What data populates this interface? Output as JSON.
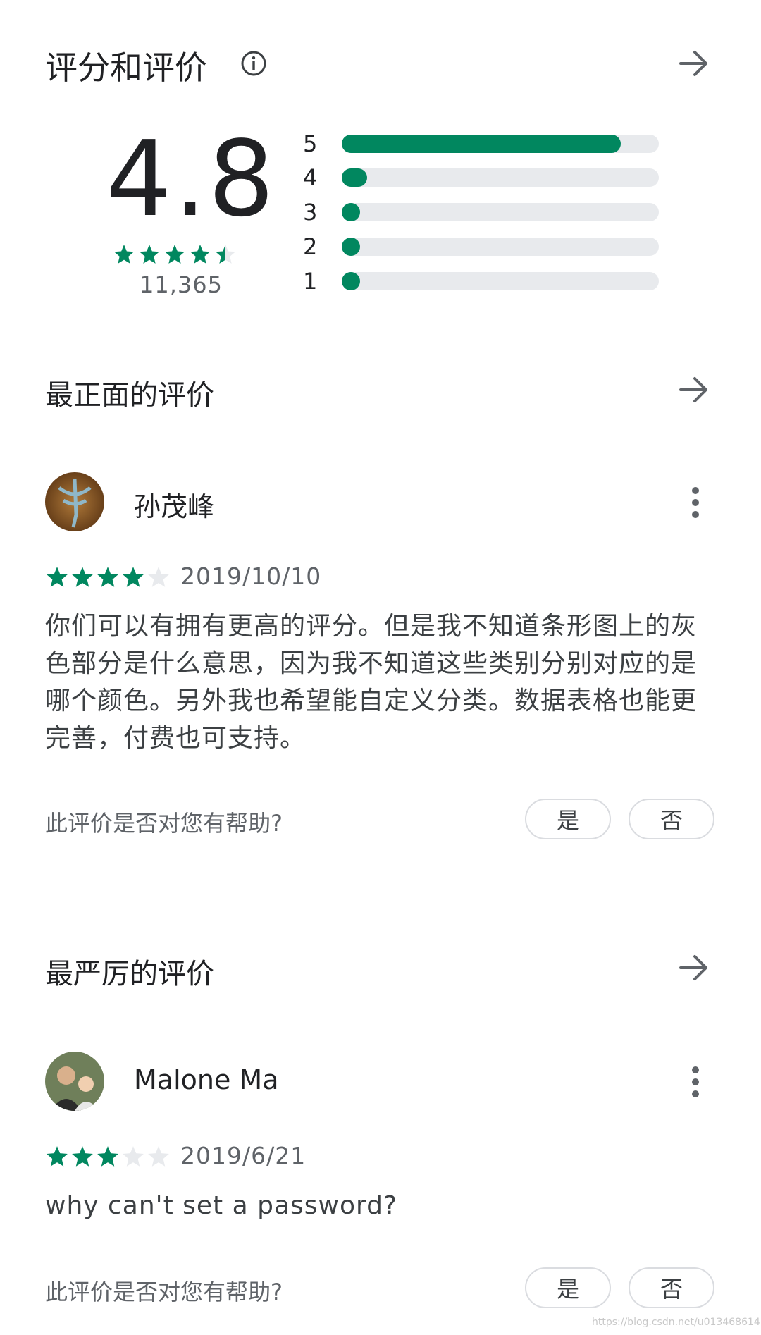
{
  "header": {
    "title": "评分和评价",
    "info_icon": "info-icon",
    "arrow_icon": "arrow-right-icon"
  },
  "summary": {
    "average": "4.8",
    "average_value": 4.8,
    "stars_filled": 4.5,
    "count": "11,365",
    "histogram": [
      {
        "label": "5",
        "fraction": 0.88
      },
      {
        "label": "4",
        "fraction": 0.08
      },
      {
        "label": "3",
        "fraction": 0.03
      },
      {
        "label": "2",
        "fraction": 0.03
      },
      {
        "label": "1",
        "fraction": 0.03
      }
    ]
  },
  "positive": {
    "section_title": "最正面的评价",
    "reviewer": "孙茂峰",
    "stars": 4,
    "date": "2019/10/10",
    "text": "你们可以有拥有更高的评分。但是我不知道条形图上的灰色部分是什么意思，因为我不知道这些类别分别对应的是哪个颜色。另外我也希望能自定义分类。数据表格也能更完善，付费也可支持。",
    "helpful_question": "此评价是否对您有帮助?",
    "yes": "是",
    "no": "否"
  },
  "critical": {
    "section_title": "最严厉的评价",
    "reviewer": "Malone Ma",
    "stars": 3,
    "date": "2019/6/21",
    "text": "why can't set a password?",
    "helpful_question": "此评价是否对您有帮助?",
    "yes": "是",
    "no": "否"
  },
  "watermark": "https://blog.csdn.net/u013468614",
  "colors": {
    "accent_green": "#01875f",
    "track_gray": "#e8eaed",
    "star_empty": "#e8eaed"
  }
}
